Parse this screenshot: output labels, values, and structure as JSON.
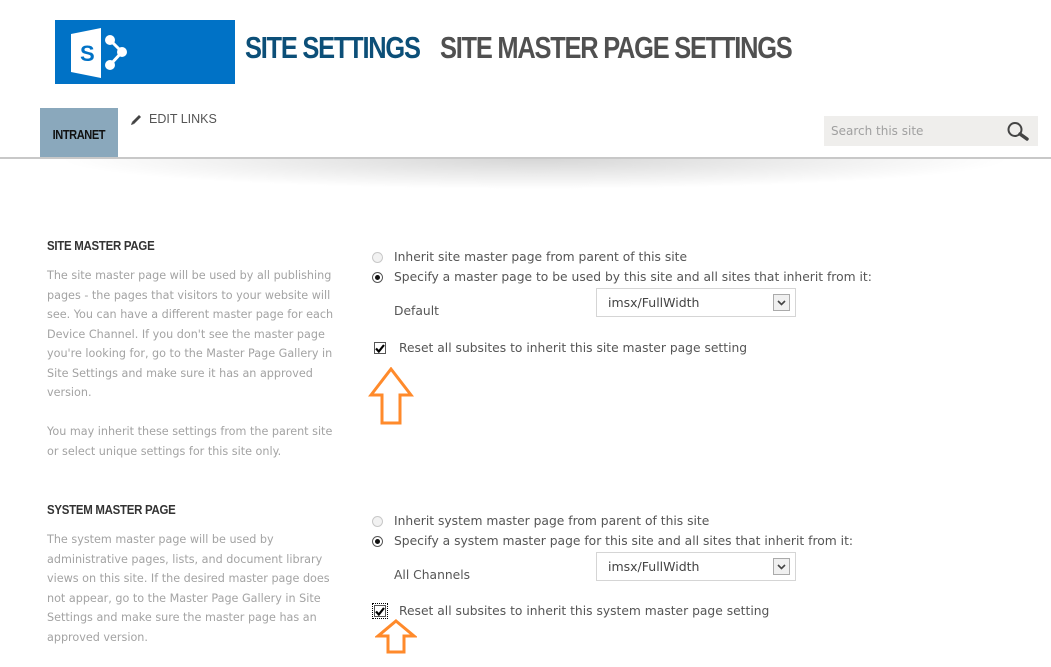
{
  "header": {
    "logo_letter": "S",
    "breadcrumb_root": "SITE SETTINGS",
    "page_title": "SITE MASTER PAGE SETTINGS",
    "colors": {
      "logo_bg": "#0072c6",
      "root_title": "#0c4f78",
      "page_title": "#505050",
      "nav_active": "#8aa8bc",
      "annotation_arrow": "#ff8a2b"
    }
  },
  "nav": {
    "items": [
      {
        "label": "INTRANET",
        "active": true
      }
    ],
    "edit_links_label": "EDIT LINKS",
    "edit_icon": "pencil-icon"
  },
  "search": {
    "placeholder": "Search this site",
    "value": "",
    "icon": "search-icon"
  },
  "sections": [
    {
      "title": "SITE MASTER PAGE",
      "description": [
        "The site master page will be used by all publishing pages - the pages that visitors to your website will see. You can have a different master page for each Device Channel. If you don't see the master page you're looking for, go to the Master Page Gallery in Site Settings and make sure it has an approved version.",
        "You may inherit these settings from the parent site or select unique settings for this site only."
      ],
      "options": [
        {
          "label": "Inherit site master page from parent of this site",
          "selected": false
        },
        {
          "label": "Specify a master page to be used by this site and all sites that inherit from it:",
          "selected": true
        }
      ],
      "channel_label": "Default",
      "select_value": "imsx/FullWidth",
      "reset_checkbox": {
        "label": "Reset all subsites to inherit this site master page setting",
        "checked": true
      }
    },
    {
      "title": "SYSTEM MASTER PAGE",
      "description": [
        "The system master page will be used by administrative pages, lists, and document library views on this site. If the desired master page does not appear, go to the Master Page Gallery in Site Settings and make sure the master page has an approved version."
      ],
      "options": [
        {
          "label": "Inherit system master page from parent of this site",
          "selected": false
        },
        {
          "label": "Specify a system master page for this site and all sites that inherit from it:",
          "selected": true
        }
      ],
      "channel_label": "All Channels",
      "select_value": "imsx/FullWidth",
      "reset_checkbox": {
        "label": "Reset all subsites to inherit this system master page setting",
        "checked": true
      }
    }
  ]
}
